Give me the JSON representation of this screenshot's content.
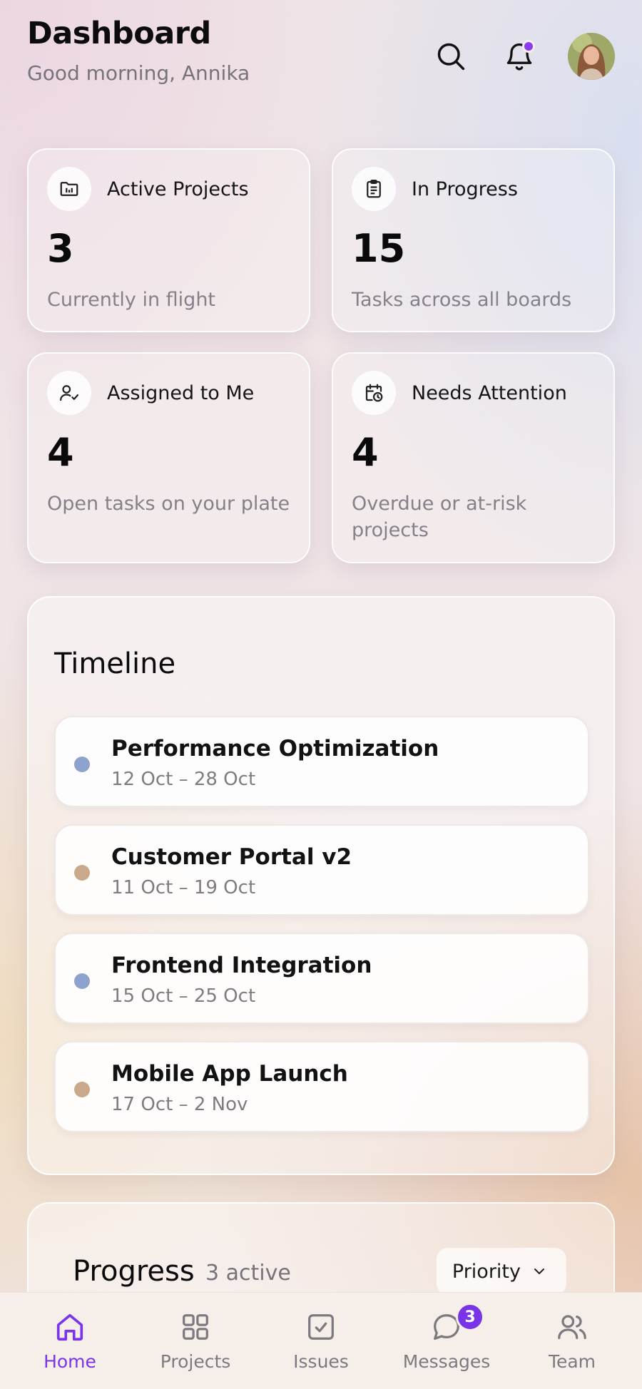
{
  "header": {
    "title": "Dashboard",
    "greeting": "Good morning, Annika",
    "notification_color": "#8b3cf0"
  },
  "stats": [
    {
      "icon": "folder-chart-icon",
      "label": "Active Projects",
      "value": "3",
      "desc": "Currently in flight"
    },
    {
      "icon": "clipboard-icon",
      "label": "In Progress",
      "value": "15",
      "desc": "Tasks across all boards"
    },
    {
      "icon": "user-check-icon",
      "label": "Assigned to Me",
      "value": "4",
      "desc": "Open tasks on your plate"
    },
    {
      "icon": "calendar-clock-icon",
      "label": "Needs Attention",
      "value": "4",
      "desc": "Overdue or at-risk projects"
    }
  ],
  "timeline": {
    "title": "Timeline",
    "items": [
      {
        "name": "Performance Optimization",
        "dates": "12 Oct – 28 Oct",
        "color": "#8ea2cf"
      },
      {
        "name": "Customer Portal v2",
        "dates": "11 Oct – 19 Oct",
        "color": "#c9a88b"
      },
      {
        "name": "Frontend Integration",
        "dates": "15 Oct – 25 Oct",
        "color": "#8ea2cf"
      },
      {
        "name": "Mobile App Launch",
        "dates": "17 Oct – 2 Nov",
        "color": "#c9a88b"
      }
    ]
  },
  "progress": {
    "title": "Progress",
    "subtitle": "3 active",
    "sort_label": "Priority"
  },
  "nav": {
    "items": [
      {
        "label": "Home",
        "icon": "home-icon",
        "active": true
      },
      {
        "label": "Projects",
        "icon": "grid-icon",
        "active": false
      },
      {
        "label": "Issues",
        "icon": "checkbox-icon",
        "active": false
      },
      {
        "label": "Messages",
        "icon": "chat-icon",
        "active": false,
        "badge": "3"
      },
      {
        "label": "Team",
        "icon": "users-icon",
        "active": false
      }
    ],
    "accent": "#7b35e8"
  }
}
